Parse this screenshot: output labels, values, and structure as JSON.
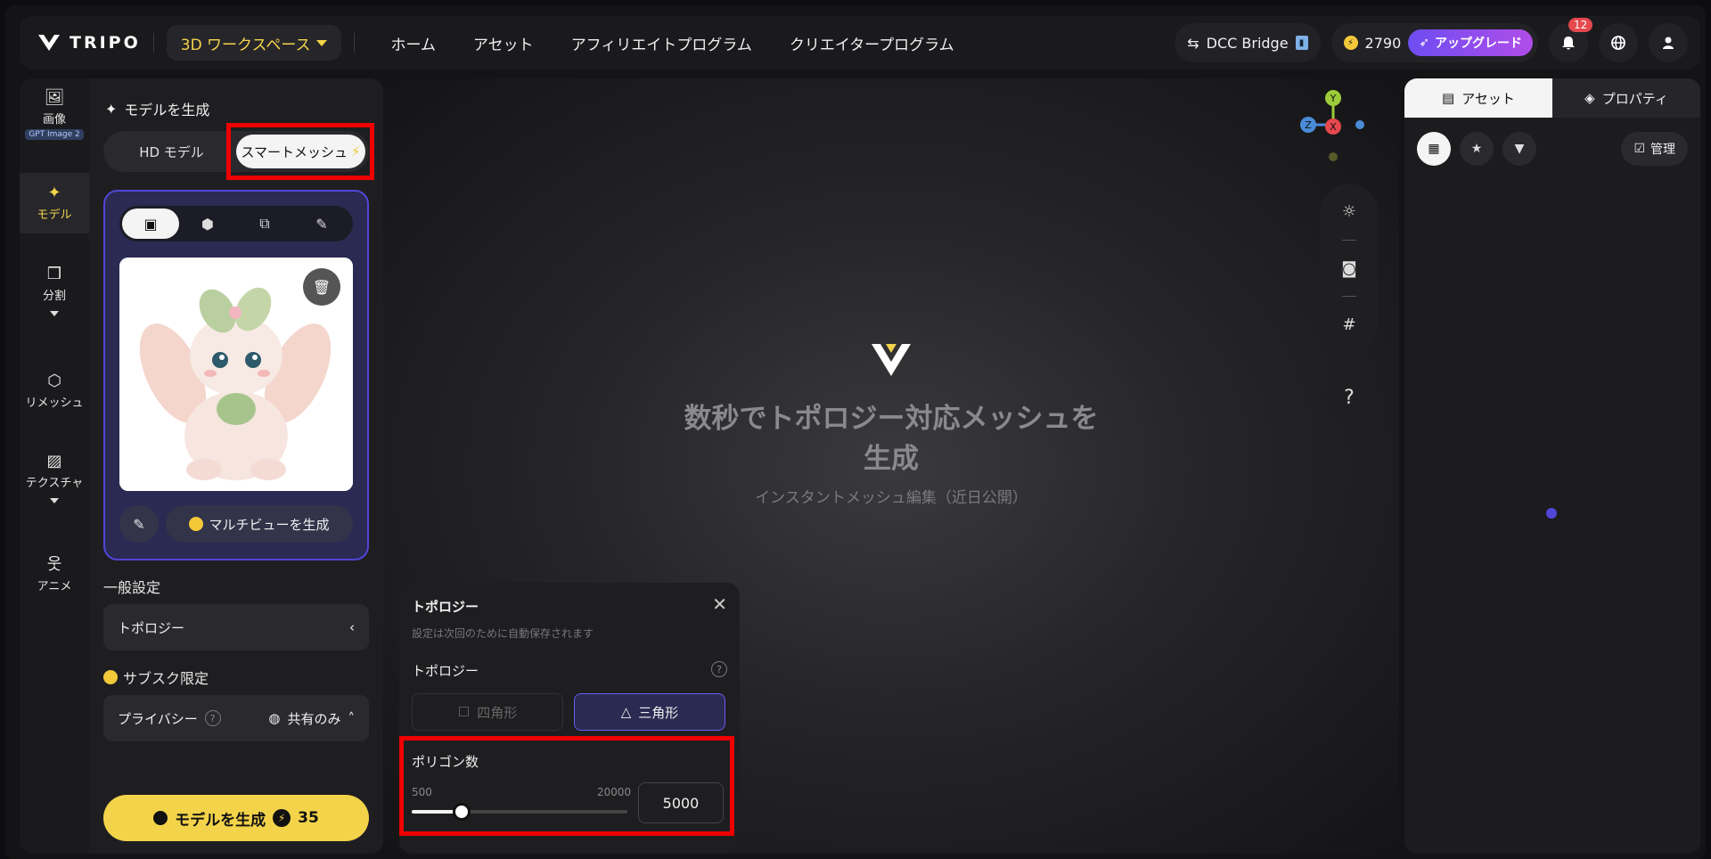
{
  "app": {
    "brand": "TRIPO"
  },
  "header": {
    "workspace": "3D ワークスペース",
    "nav": [
      "ホーム",
      "アセット",
      "アフィリエイトプログラム",
      "クリエイタープログラム"
    ],
    "dcc_bridge": "DCC Bridge",
    "credits": "2790",
    "upgrade": "アップグレード",
    "notifications": "12"
  },
  "rail": {
    "image": "画像",
    "image_badge": "GPT Image 2",
    "model": "モデル",
    "split": "分割",
    "remesh": "リメッシュ",
    "texture": "テクスチャ",
    "anime": "アニメ"
  },
  "panel": {
    "title": "モデルを生成",
    "hd_model": "HD モデル",
    "smart_mesh": "スマートメッシュ",
    "multiview": "マルチビューを生成",
    "general": "一般設定",
    "topology": "トポロジー",
    "sub_only": "サブスク限定",
    "privacy": "プライバシー",
    "privacy_value": "共有のみ",
    "generate": "モデルを生成",
    "generate_cost": "35"
  },
  "viewport": {
    "title": "数秒でトポロジー対応メッシュを生成",
    "subtitle": "インスタントメッシュ編集（近日公開）",
    "gizmo": {
      "x": "X",
      "y": "Y",
      "z": "Z"
    },
    "help": "?"
  },
  "topology_popup": {
    "title": "トポロジー",
    "note": "設定は次回のために自動保存されます",
    "topology_label": "トポロジー",
    "quad": "四角形",
    "tri": "三角形",
    "poly_label": "ポリゴン数",
    "min": "500",
    "max": "20000",
    "value": "5000",
    "slider_fraction": 0.23
  },
  "right_panel": {
    "assets_tab": "アセット",
    "properties_tab": "プロパティ",
    "manage": "管理"
  },
  "colors": {
    "accent": "#f3d34a",
    "purple": "#5146d8",
    "highlight": "#ee0000"
  }
}
